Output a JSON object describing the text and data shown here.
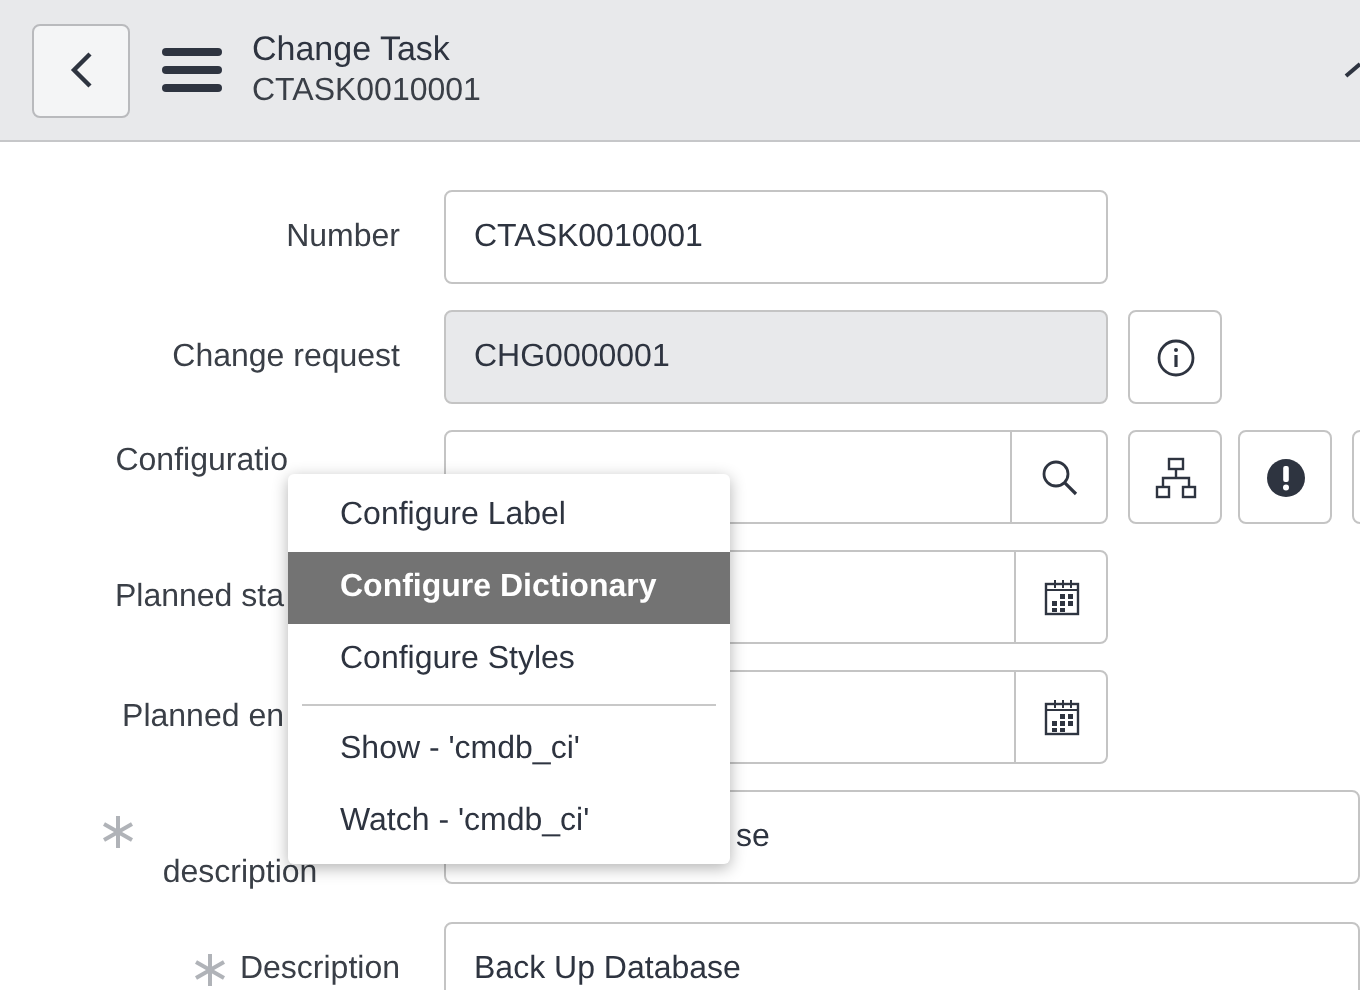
{
  "header": {
    "title": "Change Task",
    "subtitle": "CTASK0010001"
  },
  "fields": [
    {
      "kind": "text",
      "label": "Number",
      "value": "CTASK0010001",
      "required": false
    },
    {
      "kind": "readonly",
      "label": "Change request",
      "value": "CHG0000001",
      "required": false
    },
    {
      "kind": "reference",
      "label": "Configuratio",
      "required": false
    },
    {
      "kind": "date",
      "label": "Planned sta",
      "required": false
    },
    {
      "kind": "date",
      "label": "Planned en",
      "required": false
    },
    {
      "kind": "wide",
      "label": "description",
      "value": "se",
      "required": true
    },
    {
      "kind": "wide",
      "label": "Description",
      "value": "Back Up Database",
      "required": true
    }
  ],
  "context_menu": {
    "items": [
      {
        "label": "Configure Label",
        "selected": false,
        "divider_before": false
      },
      {
        "label": "Configure Dictionary",
        "selected": true,
        "divider_before": false
      },
      {
        "label": "Configure Styles",
        "selected": false,
        "divider_before": false
      },
      {
        "label": "Show - 'cmdb_ci'",
        "selected": false,
        "divider_before": true
      },
      {
        "label": "Watch - 'cmdb_ci'",
        "selected": false,
        "divider_before": false
      }
    ]
  }
}
